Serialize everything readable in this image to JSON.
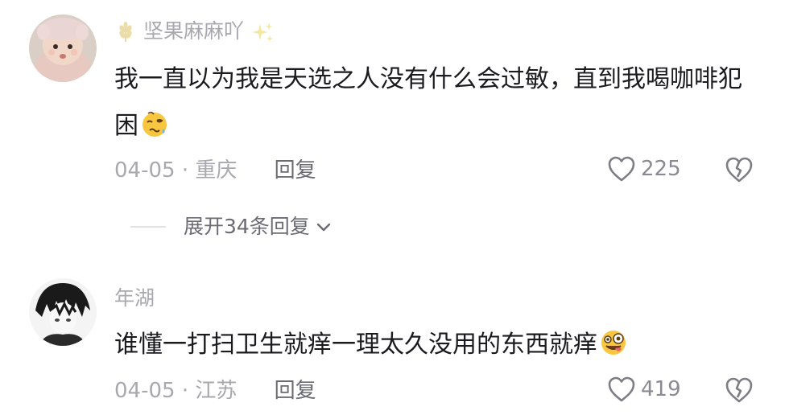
{
  "comments": [
    {
      "username": "坚果麻麻吖",
      "text": "我一直以为我是天选之人没有什么会过敏，直到我喝咖啡犯困",
      "date": "04-05",
      "location": "重庆",
      "reply_label": "回复",
      "likes": "225",
      "emoji": "woozy-face-emoji"
    },
    {
      "username": "年湖",
      "text": "谁懂一打扫卫生就痒一理太久没用的东西就痒",
      "date": "04-05",
      "location": "江苏",
      "reply_label": "回复",
      "likes": "419",
      "emoji": "zany-face-emoji"
    }
  ],
  "expand_replies": {
    "label": "展开34条回复"
  },
  "separator": "·",
  "colors": {
    "text": "#1a1a1f",
    "muted": "#a8a8ae",
    "secondary": "#6b6b73",
    "emoji_yellow": "#f9c640"
  }
}
